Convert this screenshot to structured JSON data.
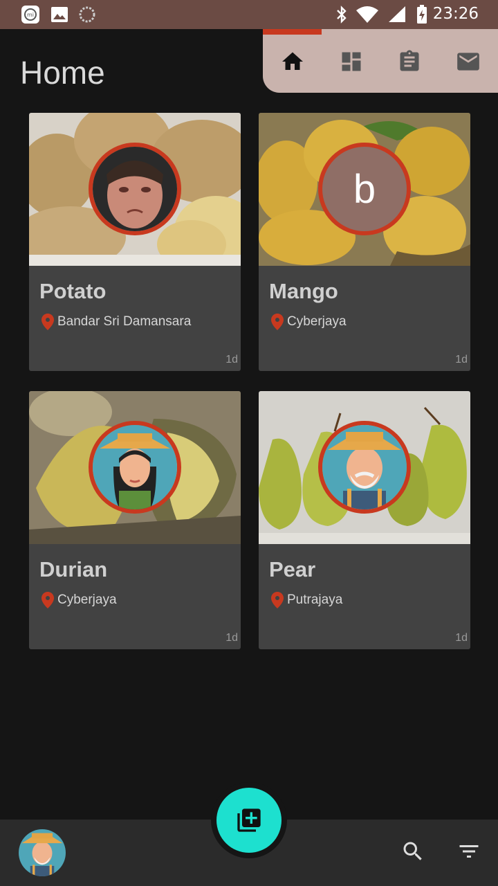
{
  "status_bar": {
    "time": "23:26",
    "icons": [
      "mi-icon",
      "image-icon",
      "loading-icon",
      "bluetooth-icon",
      "wifi-icon",
      "signal-icon",
      "battery-charging-icon"
    ]
  },
  "header": {
    "title": "Home",
    "tabs": [
      {
        "name": "home",
        "icon": "home-icon",
        "selected": true
      },
      {
        "name": "dashboard",
        "icon": "dashboard-icon",
        "selected": false
      },
      {
        "name": "assignment",
        "icon": "clipboard-icon",
        "selected": false
      },
      {
        "name": "mail",
        "icon": "mail-icon",
        "selected": false
      }
    ]
  },
  "cards": [
    {
      "title": "Potato",
      "location": "Bandar Sri Damansara",
      "age": "1d",
      "image": "potatoes-photo",
      "avatar": "face-photo"
    },
    {
      "title": "Mango",
      "location": "Cyberjaya",
      "age": "1d",
      "image": "mangoes-photo",
      "avatar": "letter-avatar",
      "avatar_letter": "b"
    },
    {
      "title": "Durian",
      "location": "Cyberjaya",
      "age": "1d",
      "image": "durian-photo",
      "avatar": "farmer-woman-avatar"
    },
    {
      "title": "Pear",
      "location": "Putrajaya",
      "age": "1d",
      "image": "pears-photo",
      "avatar": "farmer-old-man-avatar"
    }
  ],
  "bottom_bar": {
    "fab_icon": "add-to-library-icon",
    "user_avatar": "farmer-old-man-avatar",
    "actions": [
      "search-icon",
      "filter-icon"
    ]
  },
  "colors": {
    "status_bar": "#6b4b44",
    "background": "#151515",
    "card": "#424242",
    "tabs_background": "#c9b3ad",
    "accent_red": "#c8391f",
    "fab": "#1de0cf",
    "bottom_bar": "#2b2b2b"
  }
}
